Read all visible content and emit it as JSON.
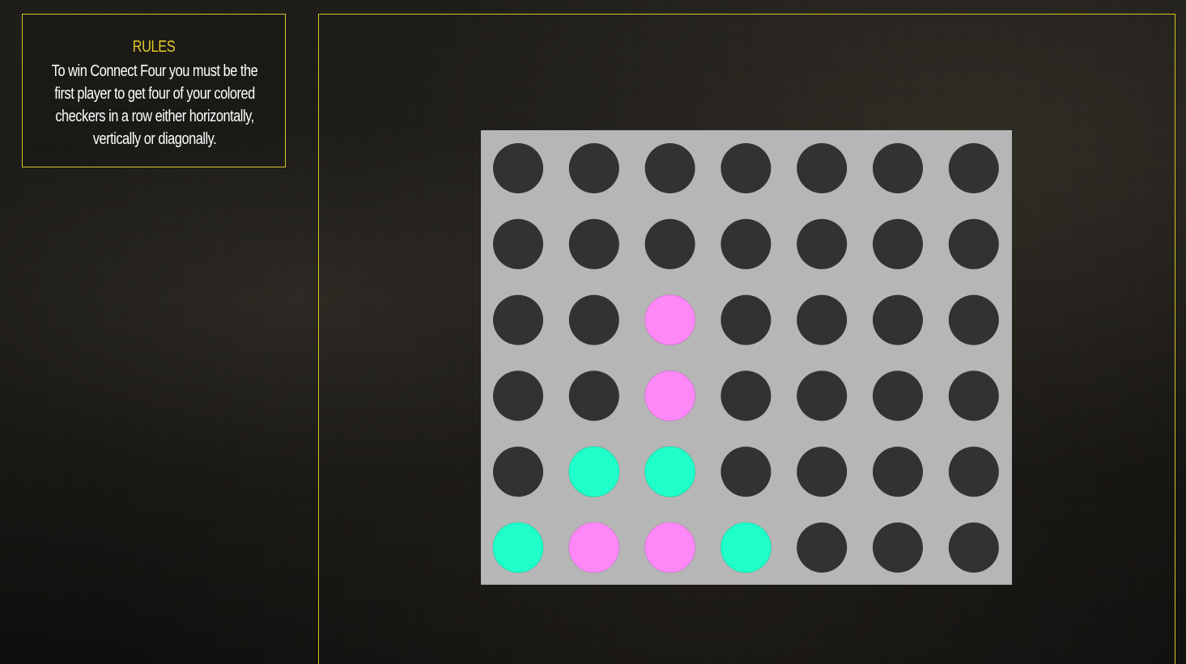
{
  "rules": {
    "title": "RULES",
    "text": "To win Connect Four you must be the first player to get four of your colored checkers in a row either horizontally, vertically or diagonally."
  },
  "colors": {
    "accent": "#d9c62a",
    "board": "#b6b6b6",
    "empty_slot": "#0e0d0c",
    "player_pink": "#ff88f8",
    "player_teal": "#1fffc9"
  },
  "board": {
    "rows": 6,
    "columns": 7,
    "cells": [
      [
        "empty",
        "empty",
        "empty",
        "empty",
        "empty",
        "empty",
        "empty"
      ],
      [
        "empty",
        "empty",
        "empty",
        "empty",
        "empty",
        "empty",
        "empty"
      ],
      [
        "empty",
        "empty",
        "pink",
        "empty",
        "empty",
        "empty",
        "empty"
      ],
      [
        "empty",
        "empty",
        "pink",
        "empty",
        "empty",
        "empty",
        "empty"
      ],
      [
        "empty",
        "teal",
        "teal",
        "empty",
        "empty",
        "empty",
        "empty"
      ],
      [
        "teal",
        "pink",
        "pink",
        "teal",
        "empty",
        "empty",
        "empty"
      ]
    ]
  }
}
